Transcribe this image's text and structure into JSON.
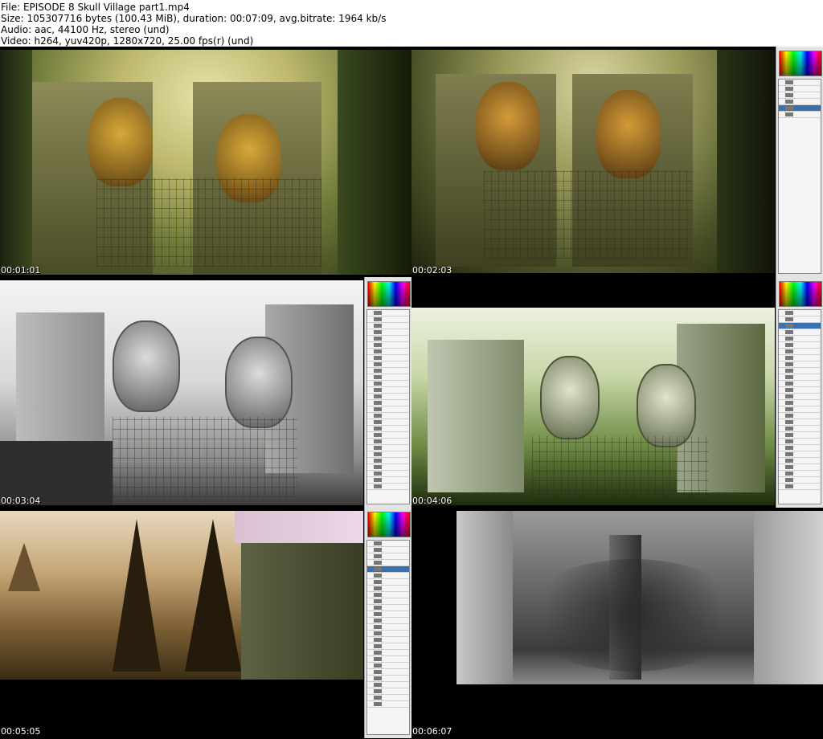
{
  "header": {
    "file_line": "File: EPISODE 8 Skull Village part1.mp4",
    "size_line": "Size: 105307716 bytes (100.43 MiB), duration: 00:07:09, avg.bitrate: 1964 kb/s",
    "audio_line": "Audio: aac, 44100 Hz, stereo (und)",
    "video_line": "Video: h264, yuv420p, 1280x720, 25.00 fps(r) (und)"
  },
  "thumbnails": [
    {
      "timestamp": "00:01:01",
      "description_icon": "skull-village-color-painting"
    },
    {
      "timestamp": "00:02:03",
      "description_icon": "skull-village-painting-with-photoshop"
    },
    {
      "timestamp": "00:03:04",
      "description_icon": "skull-village-grayscale-sketch"
    },
    {
      "timestamp": "00:04:06",
      "description_icon": "skull-village-green-painting"
    },
    {
      "timestamp": "00:05:05",
      "description_icon": "temple-ruins-photo-collage"
    },
    {
      "timestamp": "00:06:07",
      "description_icon": "grayscale-city-jungle-collage"
    }
  ],
  "colors": {
    "sheet_background": "#000000",
    "timestamp_text": "#ffffff",
    "panel_bg": "#e3e3e3",
    "selected_layer": "#3a6fb0"
  }
}
